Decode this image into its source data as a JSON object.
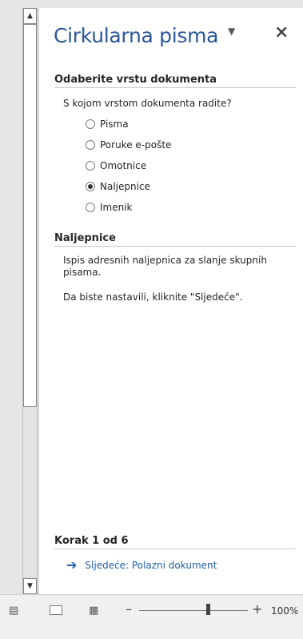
{
  "pane": {
    "title": "Cirkularna pisma",
    "section1_heading": "Odaberite vrstu dokumenta",
    "question": "S kojom vrstom dokumenta radite?",
    "options": [
      {
        "label": "Pisma",
        "selected": false
      },
      {
        "label": "Poruke e-pošte",
        "selected": false
      },
      {
        "label": "Omotnice",
        "selected": false
      },
      {
        "label": "Naljepnice",
        "selected": true
      },
      {
        "label": "Imenik",
        "selected": false
      }
    ],
    "section2_heading": "Naljepnice",
    "description": "Ispis adresnih naljepnica za slanje skupnih pisama.",
    "continue_text": "Da biste nastavili, kliknite \"Sljedeće\".",
    "step_heading": "Korak 1 od 6",
    "next_link": "Sljedeće: Polazni dokument"
  },
  "statusbar": {
    "zoom_minus": "–",
    "zoom_plus": "+",
    "zoom_level": "100%"
  },
  "icons": {
    "close": "close-icon",
    "dropdown": "chevron-down-icon",
    "next": "arrow-right-icon"
  }
}
